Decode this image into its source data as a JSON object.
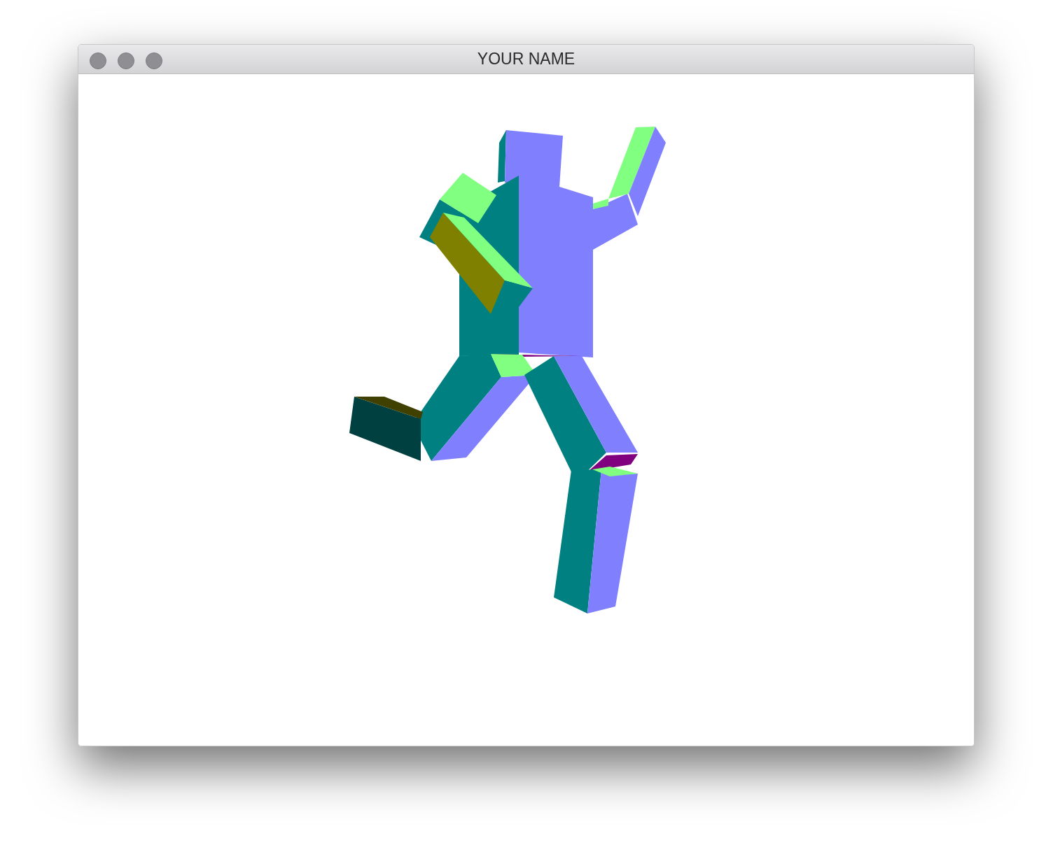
{
  "window": {
    "title": "YOUR NAME"
  }
}
